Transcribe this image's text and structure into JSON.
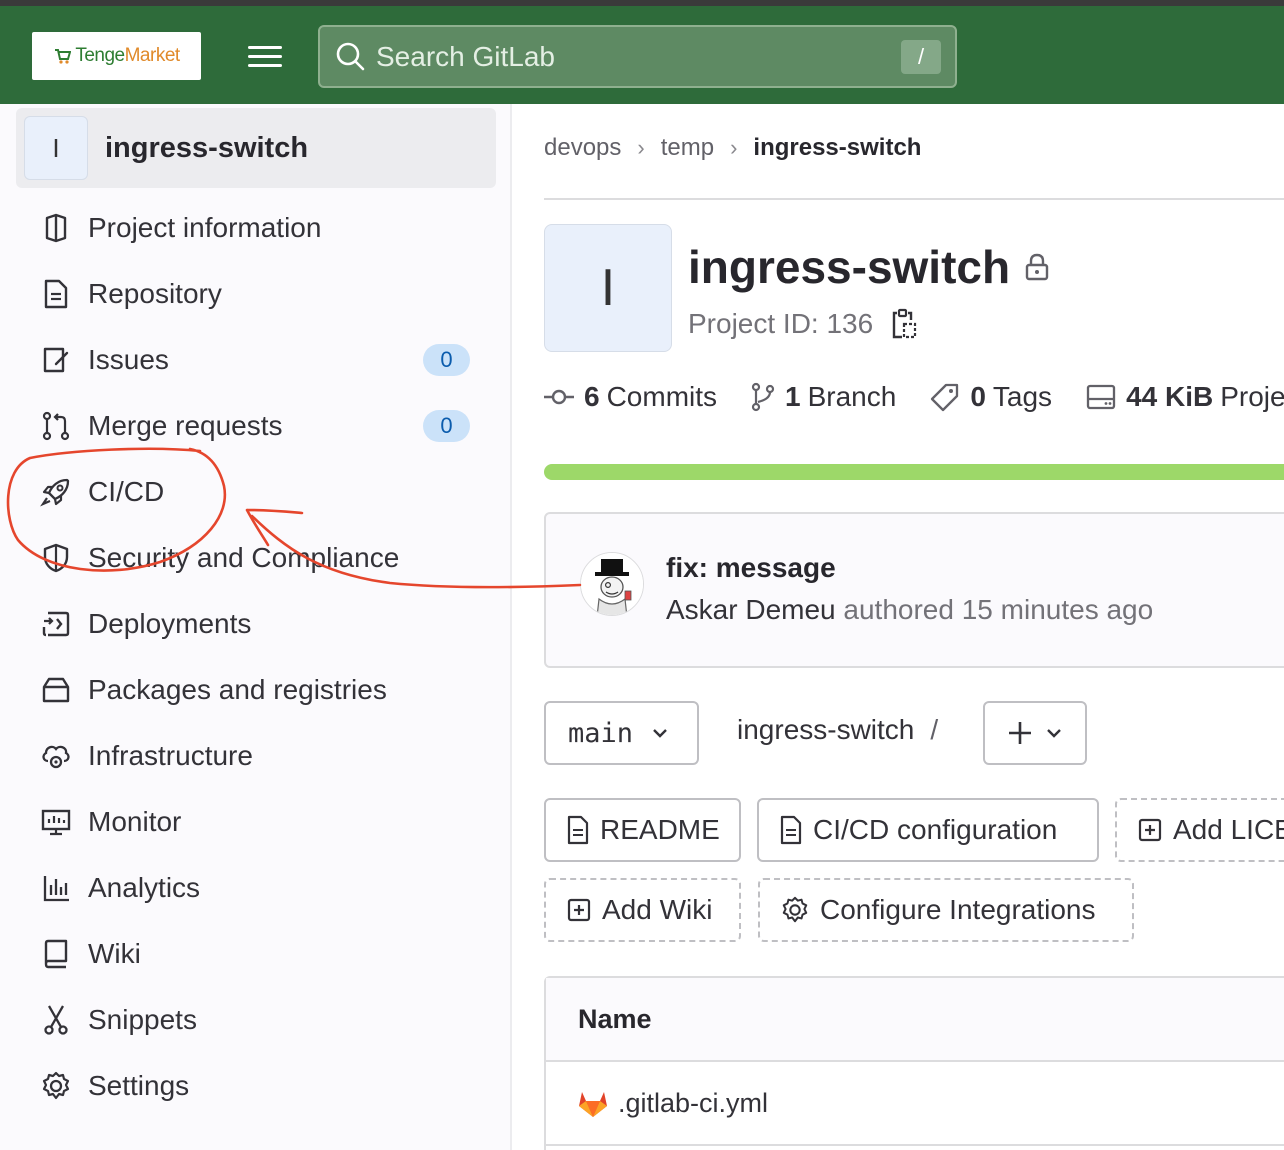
{
  "header": {
    "logo_part1": "Tenge",
    "logo_part2": "Market",
    "search_placeholder": "Search GitLab",
    "search_shortcut": "/"
  },
  "sidebar": {
    "project_avatar": "I",
    "project_name": "ingress-switch",
    "items": [
      {
        "label": "Project information",
        "icon": "project-information-icon"
      },
      {
        "label": "Repository",
        "icon": "repository-icon"
      },
      {
        "label": "Issues",
        "icon": "issues-icon",
        "badge": "0"
      },
      {
        "label": "Merge requests",
        "icon": "merge-requests-icon",
        "badge": "0"
      },
      {
        "label": "CI/CD",
        "icon": "rocket-icon"
      },
      {
        "label": "Security and Compliance",
        "icon": "shield-icon"
      },
      {
        "label": "Deployments",
        "icon": "deployments-icon"
      },
      {
        "label": "Packages and registries",
        "icon": "package-icon"
      },
      {
        "label": "Infrastructure",
        "icon": "cloud-gear-icon"
      },
      {
        "label": "Monitor",
        "icon": "monitor-icon"
      },
      {
        "label": "Analytics",
        "icon": "analytics-icon"
      },
      {
        "label": "Wiki",
        "icon": "book-icon"
      },
      {
        "label": "Snippets",
        "icon": "scissors-icon"
      },
      {
        "label": "Settings",
        "icon": "gear-icon"
      }
    ]
  },
  "breadcrumb": {
    "items": [
      "devops",
      "temp",
      "ingress-switch"
    ]
  },
  "project": {
    "avatar": "I",
    "name": "ingress-switch",
    "id_label": "Project ID: 136"
  },
  "stats": {
    "commits_count": "6",
    "commits_label": "Commits",
    "branch_count": "1",
    "branch_label": "Branch",
    "tags_count": "0",
    "tags_label": "Tags",
    "storage_value": "44 KiB",
    "storage_label": "Project Storage"
  },
  "last_commit": {
    "title": "fix: message",
    "author": "Askar Demeu",
    "meta": "authored 15 minutes ago"
  },
  "repo_nav": {
    "branch": "main",
    "path": "ingress-switch",
    "path_sep": "/"
  },
  "quick_actions": {
    "readme": "README",
    "cicd_config": "CI/CD configuration",
    "add_license": "Add LICENSE",
    "add_wiki": "Add Wiki",
    "configure_integrations": "Configure Integrations"
  },
  "file_table": {
    "header_name": "Name",
    "rows": [
      ".gitlab-ci.yml"
    ]
  },
  "colors": {
    "topbar": "#2e6b3a",
    "annotation": "#e5462d",
    "progress": "#9dd869",
    "badge_bg": "#cbe2f9"
  }
}
